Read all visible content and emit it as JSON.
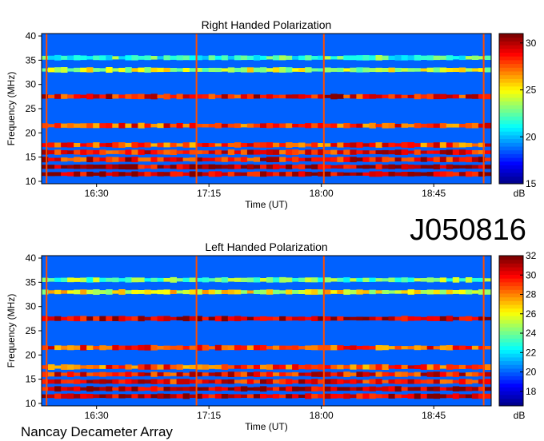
{
  "header": {
    "label": "J050816"
  },
  "footer": {
    "observatory": "Nancay Decameter Array"
  },
  "colors": {
    "colormap": [
      "#00008f",
      "#0000ff",
      "#0080ff",
      "#00ffff",
      "#80ff80",
      "#ffff00",
      "#ff8000",
      "#ff0000",
      "#800000"
    ]
  },
  "chart_data": [
    {
      "type": "heatmap",
      "title": "Right Handed Polarization",
      "xlabel": "Time (UT)",
      "ylabel": "Frequency (MHz)",
      "xlim": [
        "16:08",
        "19:08"
      ],
      "ylim": [
        9.5,
        40.5
      ],
      "xticks": [
        "16:30",
        "17:15",
        "18:00",
        "18:45"
      ],
      "yticks": [
        10,
        15,
        20,
        25,
        30,
        35,
        40
      ],
      "colorbar": {
        "label": "dB",
        "range": [
          15,
          31
        ],
        "ticks": [
          15,
          20,
          25,
          30
        ]
      },
      "bands": [
        {
          "freq": 11.5,
          "level": 30
        },
        {
          "freq": 13,
          "level": 30
        },
        {
          "freq": 14.5,
          "level": 29
        },
        {
          "freq": 16,
          "level": 29
        },
        {
          "freq": 17.5,
          "level": 28
        },
        {
          "freq": 21.5,
          "level": 28
        },
        {
          "freq": 27.5,
          "level": 29
        },
        {
          "freq": 33,
          "level": 24
        },
        {
          "freq": 35.5,
          "level": 22
        }
      ],
      "vertical_lines": [
        "16:10",
        "17:10",
        "18:01",
        "19:05"
      ]
    },
    {
      "type": "heatmap",
      "title": "Left Handed Polarization",
      "xlabel": "Time (UT)",
      "ylabel": "Frequency (MHz)",
      "xlim": [
        "16:08",
        "19:08"
      ],
      "ylim": [
        9.5,
        40.5
      ],
      "xticks": [
        "16:30",
        "17:15",
        "18:00",
        "18:45"
      ],
      "yticks": [
        10,
        15,
        20,
        25,
        30,
        35,
        40
      ],
      "colorbar": {
        "label": "dB",
        "range": [
          16.5,
          32
        ],
        "ticks": [
          18,
          20,
          22,
          24,
          26,
          28,
          30,
          32
        ]
      },
      "bands": [
        {
          "freq": 11.5,
          "level": 31
        },
        {
          "freq": 13,
          "level": 31
        },
        {
          "freq": 14.5,
          "level": 30
        },
        {
          "freq": 16,
          "level": 30
        },
        {
          "freq": 17.5,
          "level": 29
        },
        {
          "freq": 21.5,
          "level": 29
        },
        {
          "freq": 27.5,
          "level": 31
        },
        {
          "freq": 33,
          "level": 26
        },
        {
          "freq": 35.5,
          "level": 24
        }
      ],
      "vertical_lines": [
        "16:10",
        "17:10",
        "18:01",
        "19:05"
      ]
    }
  ]
}
